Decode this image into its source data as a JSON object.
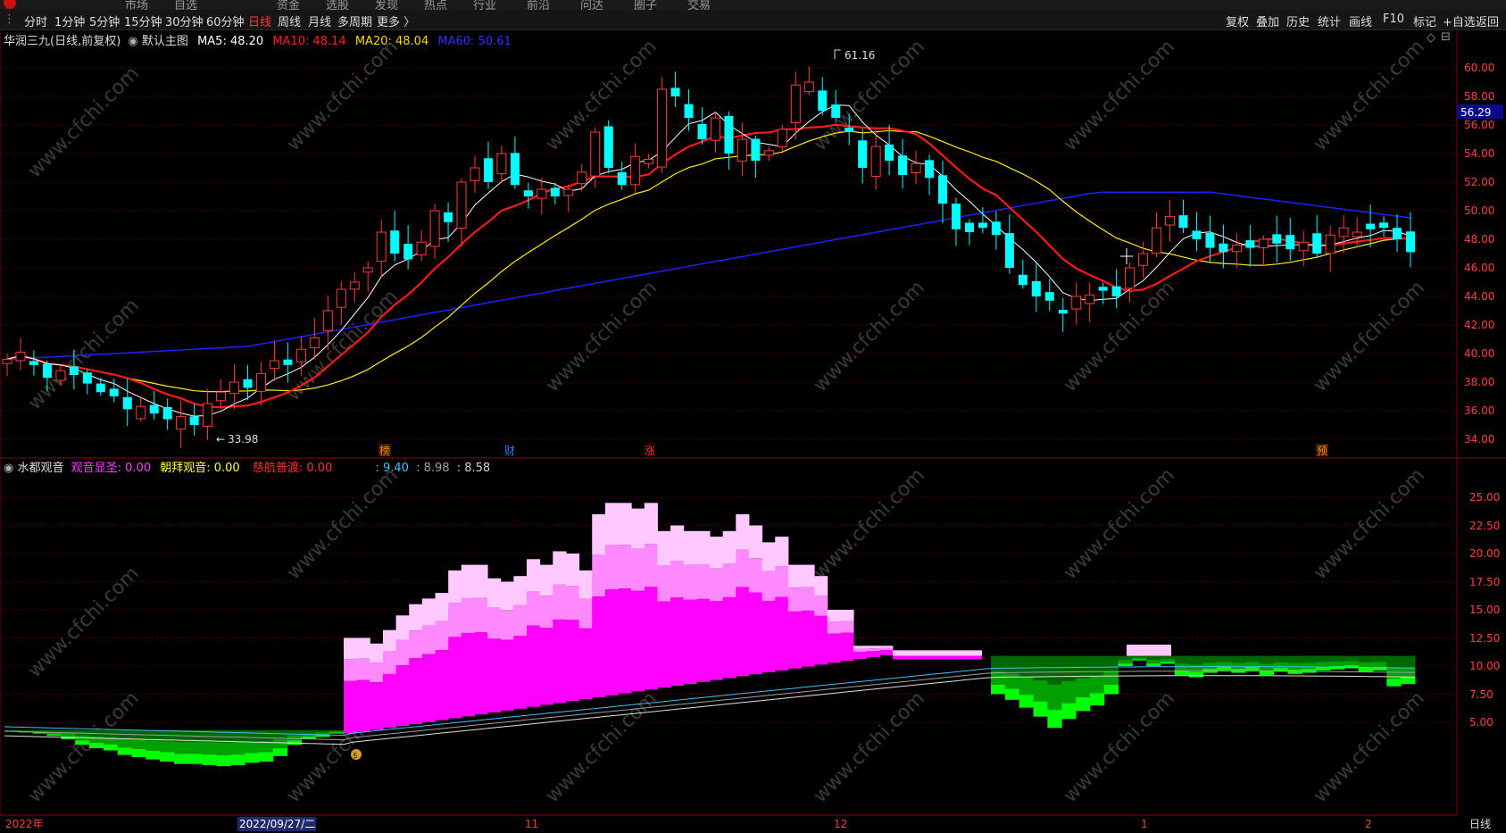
{
  "topbar": {
    "items": [
      "市场",
      "自选",
      "资金",
      "选股",
      "发现",
      "热点",
      "行业",
      "前沿",
      "问达",
      "圈子",
      "交易"
    ]
  },
  "toolbar": {
    "left": [
      "分时",
      "1分钟",
      "5分钟",
      "15分钟",
      "30分钟",
      "60分钟",
      "日线",
      "周线",
      "月线",
      "多周期",
      "更多 〉"
    ],
    "active_index": 6,
    "right": [
      "复权",
      "叠加",
      "历史",
      "统计",
      "画线",
      "F10",
      "标记",
      "+自选",
      "返回"
    ]
  },
  "main_chart": {
    "stock": "华润三九(日线,前复权)",
    "template": "默认主图",
    "ma": [
      {
        "label": "MA5: 48.20",
        "color": "#ffffff"
      },
      {
        "label": "MA10: 48.14",
        "color": "#ff2020"
      },
      {
        "label": "MA20: 48.04",
        "color": "#ffd700"
      },
      {
        "label": "MA60: 50.61",
        "color": "#2a2aff"
      }
    ],
    "y_ticks": [
      "60.00",
      "58.00",
      "56.00",
      "54.00",
      "52.00",
      "50.00",
      "48.00",
      "46.00",
      "44.00",
      "42.00",
      "40.00",
      "38.00",
      "36.00",
      "34.00"
    ],
    "price_tag": "56.29",
    "high_label": "61.16",
    "low_label": "33.98",
    "event_markers": [
      "榜",
      "财",
      "涨",
      "预"
    ]
  },
  "indicator": {
    "name": "水都观音",
    "params": [
      {
        "label": "观音显圣: 0.00",
        "color": "#ff40ff"
      },
      {
        "label": "朝拜观音: 0.00",
        "color": "#ffff40"
      },
      {
        "label": "慈航普渡: 0.00",
        "color": "#ff3030"
      },
      {
        "label": ": 9.40",
        "color": "#40c0ff"
      },
      {
        "label": ": 8.98",
        "color": "#a0a0a0"
      },
      {
        "label": ": 8.58",
        "color": "#d0d0d0"
      }
    ],
    "y_ticks": [
      "25.00",
      "22.50",
      "20.00",
      "17.50",
      "15.00",
      "12.50",
      "10.00",
      "7.50",
      "5.00"
    ]
  },
  "date_axis": {
    "labels": [
      "2022年",
      "2022/09/27/二",
      "11",
      "12",
      "1",
      "2"
    ],
    "period": "日线"
  },
  "watermark": "www.cfchi.com",
  "colors": {
    "up": "#ff3b3b",
    "down": "#00ffff",
    "ma5": "#ffffff",
    "ma10": "#ff1a1a",
    "ma20": "#ffee00",
    "ma60": "#2020ff",
    "pink": "#ff00ff",
    "green": "#00cc00"
  }
}
